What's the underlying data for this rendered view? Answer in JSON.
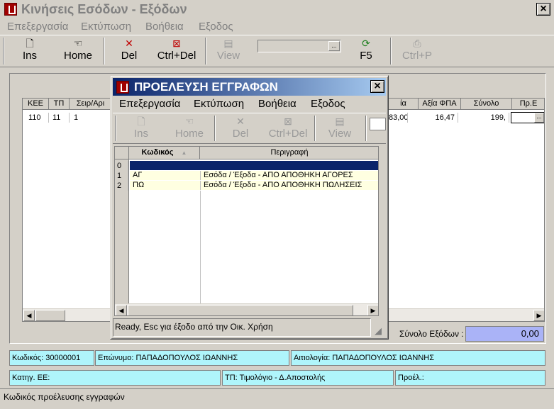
{
  "window": {
    "title": "Κινήσεις Εσόδων - Εξόδων",
    "close_glyph": "×",
    "icon": "app-icon"
  },
  "menu": [
    "Επεξεργασία",
    "Εκτύπωση",
    "Βοήθεια",
    "Εξοδος"
  ],
  "toolbar": {
    "ins": "Ins",
    "home": "Home",
    "del": "Del",
    "ctrl_del": "Ctrl+Del",
    "view": "View",
    "f5": "F5",
    "ctrl_p": "Ctrl+P",
    "combo_glyph": "..."
  },
  "main_grid": {
    "columns": [
      "ΚΕΕ",
      "ΤΠ",
      "Σειρ/Αρι",
      "ία",
      "Αξία ΦΠΑ",
      "Σύνολο",
      "Πρ.Ε"
    ],
    "row": {
      "kee": "110",
      "tp": "11",
      "seira": "1",
      "axia": "83,00",
      "fpa": "16,47",
      "synolo": "199,",
      "edit_glyph": "..."
    }
  },
  "totals": {
    "label": "Σύνολο Εξόδων :",
    "value": "0,00"
  },
  "info": {
    "kodikos": "Κωδικός: 30000001",
    "eponymo": "Επώνυμο: ΠΑΠΑΔΟΠΟΥΛΟΣ ΙΩΑΝΝΗΣ",
    "aitiologia": "Αιτιολογία: ΠΑΠΑΔΟΠΟΥΛΟΣ ΙΩΑΝΝΗΣ",
    "katigoria": "Κατηγ. ΕΕ:",
    "tp": "ΤΠ: Τιμολόγιο - Δ.Αποστολής",
    "proel": "Προέλ.:"
  },
  "statusbar": "Κωδικός προέλευσης εγγραφών",
  "dialog": {
    "title": "ΠΡΟΕΛΕΥΣΗ ΕΓΓΡΑΦΩΝ",
    "close_glyph": "×",
    "menu": [
      "Επεξεργασία",
      "Εκτύπωση",
      "Βοήθεια",
      "Εξοδος"
    ],
    "toolbar": {
      "ins": "Ins",
      "home": "Home",
      "del": "Del",
      "ctrl_del": "Ctrl+Del",
      "view": "View"
    },
    "columns": {
      "code": "Κωδικός",
      "sort_glyph": "▲",
      "desc": "Περιγραφή"
    },
    "rows": [
      {
        "idx": "0",
        "code": "",
        "desc": ""
      },
      {
        "idx": "1",
        "code": "ΑΓ",
        "desc": "Εσόδα / Έξοδα - ΑΠΟ ΑΠΟΘΗΚΗ ΑΓΟΡΕΣ"
      },
      {
        "idx": "2",
        "code": "ΠΩ",
        "desc": "Εσόδα / Έξοδα - ΑΠΟ ΑΠΟΘΗΚΗ ΠΩΛΗΣΕΙΣ"
      }
    ],
    "status": "Ready, Esc για έξοδο από την Οικ. Χρήση"
  }
}
